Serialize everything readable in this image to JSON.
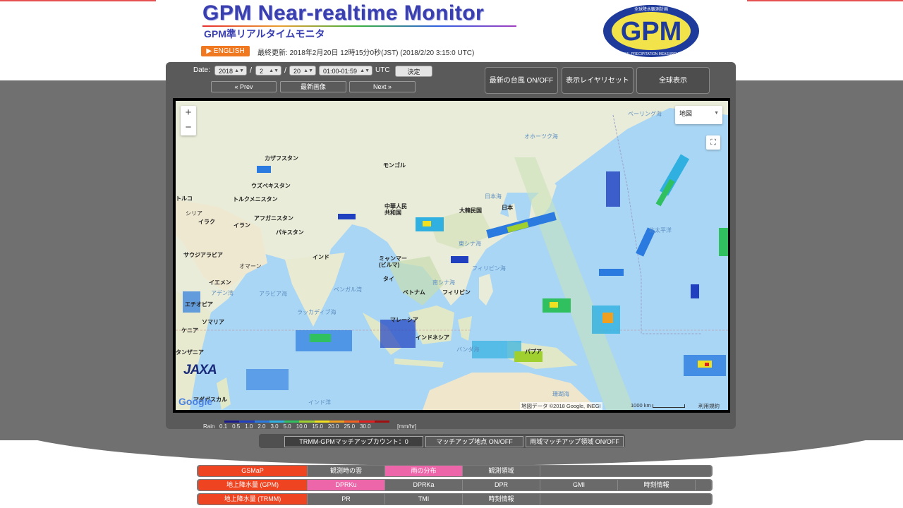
{
  "header": {
    "title_en": "GPM Near-realtime Monitor",
    "title_ja": "GPM準リアルタイムモニタ",
    "logo_text": "GPM",
    "logo_ring_top": "全球降水観測計画",
    "logo_ring_bottom": "GLOBAL PRECIPITATION MEASUREMENT",
    "english_button": "▶ ENGLISH",
    "last_updated": "最終更新: 2018年2月20日 12時15分0秒(JST) (2018/2/20 3:15:0 UTC)"
  },
  "date_controls": {
    "label": "Date:",
    "year": "2018",
    "month": "2",
    "day": "20",
    "time_range": "01:00-01:59",
    "utc": "UTC",
    "slash": "/",
    "apply": "決定",
    "prev": "« Prev",
    "latest": "最新画像",
    "next": "Next »"
  },
  "toolbar": {
    "typhoon": "最新の台風 ON/OFF",
    "reset_layers": "表示レイヤリセット",
    "global_view": "全球表示"
  },
  "map": {
    "map_type": "地図",
    "zoom_in": "+",
    "zoom_out": "−",
    "attribution": "地図データ ©2018 Google, INEGI",
    "scale": "1000 km",
    "terms": "利用規約",
    "google": "Google",
    "jaxa": "JAXA",
    "labels": {
      "kazakhstan": "カザフスタン",
      "mongolia": "モンゴル",
      "uzbekistan": "ウズベキスタン",
      "turkmenistan": "トルクメニスタン",
      "afghanistan": "アフガニスタン",
      "pakistan": "パキスタン",
      "iran": "イラン",
      "iraq": "イラク",
      "syria": "シリア",
      "turkey": "トルコ",
      "saudi": "サウジアラビア",
      "oman": "オマーン",
      "yemen": "イエメン",
      "ethiopia": "エチオピア",
      "somalia": "ソマリア",
      "kenya": "ケニア",
      "tanzania": "タンザニア",
      "india": "インド",
      "china": "中華人民\n共和国",
      "korea": "大韓民国",
      "japan": "日本",
      "myanmar": "ミャンマー\n(ビルマ)",
      "thailand": "タイ",
      "vietnam": "ベトナム",
      "philippines": "フィリピン",
      "malaysia": "マレーシア",
      "indonesia": "インドネシア",
      "png": "パプア",
      "madagascar": "マダガスカル",
      "arabian_sea": "アラビア海",
      "bengal": "ベンガル湾",
      "laccadive": "ラッカディブ海",
      "gulf_aden": "アデン湾",
      "okhotsk": "オホーツク海",
      "bering": "ベーリング海",
      "japan_sea": "日本海",
      "east_china_sea": "東シナ海",
      "south_china_sea": "南シナ海",
      "philippine_sea": "フィリピン海",
      "north_pacific": "北太平洋",
      "indian_ocean": "インド洋",
      "banda": "バンダ海",
      "coral": "珊瑚海"
    }
  },
  "legend": {
    "label": "Rain",
    "ticks": [
      "0.1",
      "0.5",
      "1.0",
      "2.0",
      "3.0",
      "5.0",
      "10.0",
      "15.0",
      "20.0",
      "25.0",
      "30.0"
    ],
    "unit": "[mm/hr]",
    "colors": [
      "#1a1a8a",
      "#2040c0",
      "#2a7ae0",
      "#30b0e0",
      "#30c060",
      "#a0d030",
      "#f0e020",
      "#f0a020",
      "#f06020",
      "#e02020",
      "#a01010"
    ]
  },
  "matchup": {
    "count": "TRMM-GPMマッチアップカウント：0",
    "points": "マッチアップ地点 ON/OFF",
    "area": "雨域マッチアップ領域 ON/OFF"
  },
  "layer_rows": [
    {
      "head": "GSMaP",
      "cells": [
        "観測時の雲",
        "雨の分布",
        "観測領域",
        ""
      ]
    },
    {
      "head": "地上降水量 (GPM)",
      "cells": [
        "DPRKu",
        "DPRKa",
        "DPR",
        "GMI",
        "時刻情報"
      ]
    },
    {
      "head": "地上降水量 (TRMM)",
      "cells": [
        "PR",
        "TMI",
        "時刻情報",
        ""
      ]
    }
  ],
  "colors": {
    "accent_orange": "#f07820",
    "active_red": "#ee4422",
    "active_pink": "#ee66aa",
    "title_blue": "#3a3fb0"
  }
}
